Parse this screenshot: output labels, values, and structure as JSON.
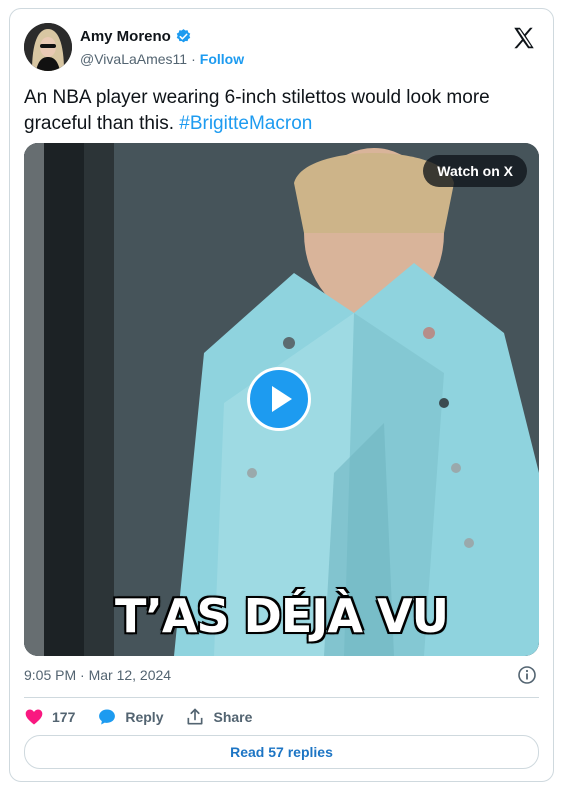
{
  "author": {
    "name": "Amy Moreno",
    "handle": "@VivaLaAmes11",
    "separator": "·",
    "follow_label": "Follow"
  },
  "tweet": {
    "text": "An NBA player wearing 6-inch stilettos would look more graceful than this. ",
    "hashtag": "#BrigitteMacron"
  },
  "media": {
    "watch_label": "Watch on X",
    "caption": "T’AS DÉJÀ VU"
  },
  "meta": {
    "timestamp": "9:05 PM · Mar 12, 2024"
  },
  "actions": {
    "likes": "177",
    "reply_label": "Reply",
    "share_label": "Share"
  },
  "footer": {
    "read_replies_label": "Read 57 replies"
  },
  "colors": {
    "accent": "#1d9bf0",
    "like": "#f91880"
  },
  "icons": [
    "x-logo-icon",
    "verified-icon",
    "play-icon",
    "info-icon",
    "heart-icon",
    "reply-bubble-icon",
    "share-icon"
  ]
}
